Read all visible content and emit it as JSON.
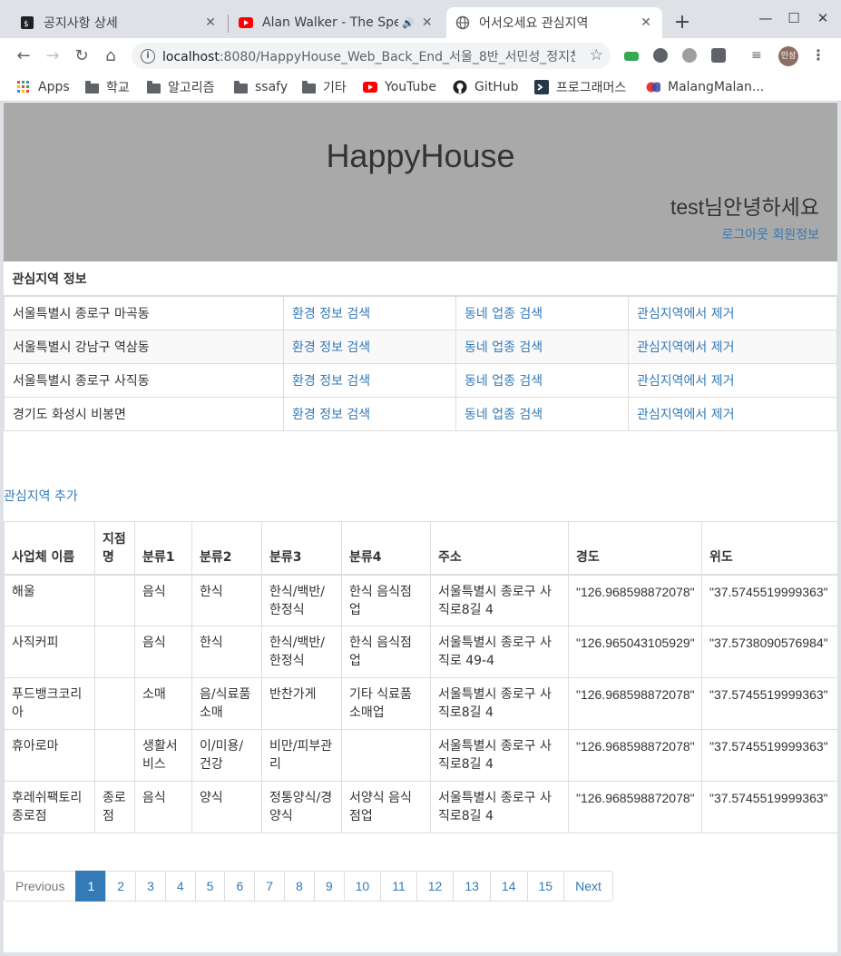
{
  "browser": {
    "tabs": [
      {
        "title": "공지사항 상세",
        "icon": "terminal-icon",
        "active": false
      },
      {
        "title": "Alan Walker - The Spec",
        "icon": "youtube-icon",
        "active": false
      },
      {
        "title": "어서오세요 관심지역",
        "icon": "globe-icon",
        "active": true
      }
    ],
    "url_host": "localhost",
    "url_path": ":8080/HappyHouse_Web_Back_End_서울_8반_서민성_정지찬/...",
    "profile_initials": "민성",
    "bookmarks": [
      {
        "label": "Apps",
        "icon": "apps-grid-icon"
      },
      {
        "label": "학교",
        "icon": "folder-icon"
      },
      {
        "label": "알고리즘",
        "icon": "folder-icon"
      },
      {
        "label": "ssafy",
        "icon": "folder-icon"
      },
      {
        "label": "기타",
        "icon": "folder-icon"
      },
      {
        "label": "YouTube",
        "icon": "youtube-icon"
      },
      {
        "label": "GitHub",
        "icon": "github-icon"
      },
      {
        "label": "프로그래머스",
        "icon": "programmers-icon"
      },
      {
        "label": "MalangMalan...",
        "icon": "malang-icon"
      }
    ],
    "colors": {
      "tabbar": "#dee1e6",
      "youtube": "#ff0000",
      "link": "#337ab7",
      "header_bg": "#a9a9a9"
    }
  },
  "header": {
    "title": "HappyHouse",
    "welcome": "test님안녕하세요",
    "logout": "로그아웃",
    "member_info": "회원정보"
  },
  "favorites": {
    "heading": "관심지역 정보",
    "rows": [
      {
        "region": "서울특별시 종로구 마곡동",
        "env": "환경 정보 검색",
        "biz": "동네 업종 검색",
        "remove": "관심지역에서 제거"
      },
      {
        "region": "서울특별시 강남구 역삼동",
        "env": "환경 정보 검색",
        "biz": "동네 업종 검색",
        "remove": "관심지역에서 제거"
      },
      {
        "region": "서울특별시 종로구 사직동",
        "env": "환경 정보 검색",
        "biz": "동네 업종 검색",
        "remove": "관심지역에서 제거"
      },
      {
        "region": "경기도 화성시 비봉면",
        "env": "환경 정보 검색",
        "biz": "동네 업종 검색",
        "remove": "관심지역에서 제거"
      }
    ],
    "add_label": "관심지역 추가"
  },
  "business": {
    "columns": [
      "사업체 이름",
      "지점명",
      "분류1",
      "분류2",
      "분류3",
      "분류4",
      "주소",
      "경도",
      "위도"
    ],
    "rows": [
      [
        "해울",
        "",
        "음식",
        "한식",
        "한식/백반/한정식",
        "한식 음식점업",
        "서울특별시 종로구 사직로8길 4",
        "\"126.968598872078\"",
        "\"37.5745519999363\""
      ],
      [
        "사직커피",
        "",
        "음식",
        "한식",
        "한식/백반/한정식",
        "한식 음식점업",
        "서울특별시 종로구 사직로 49-4",
        "\"126.965043105929\"",
        "\"37.5738090576984\""
      ],
      [
        "푸드뱅크코리아",
        "",
        "소매",
        "음/식료품소매",
        "반찬가게",
        "기타 식료품 소매업",
        "서울특별시 종로구 사직로8길 4",
        "\"126.968598872078\"",
        "\"37.5745519999363\""
      ],
      [
        "휴아로마",
        "",
        "생활서비스",
        "이/미용/건강",
        "비만/피부관리",
        "",
        "서울특별시 종로구 사직로8길 4",
        "\"126.968598872078\"",
        "\"37.5745519999363\""
      ],
      [
        "후레쉬팩토리 종로점",
        "종로점",
        "음식",
        "양식",
        "정통양식/경양식",
        "서양식 음식점업",
        "서울특별시 종로구 사직로8길 4",
        "\"126.968598872078\"",
        "\"37.5745519999363\""
      ]
    ]
  },
  "pagination": {
    "previous": "Previous",
    "next": "Next",
    "pages": [
      "1",
      "2",
      "3",
      "4",
      "5",
      "6",
      "7",
      "8",
      "9",
      "10",
      "11",
      "12",
      "13",
      "14",
      "15"
    ],
    "current": "1"
  }
}
